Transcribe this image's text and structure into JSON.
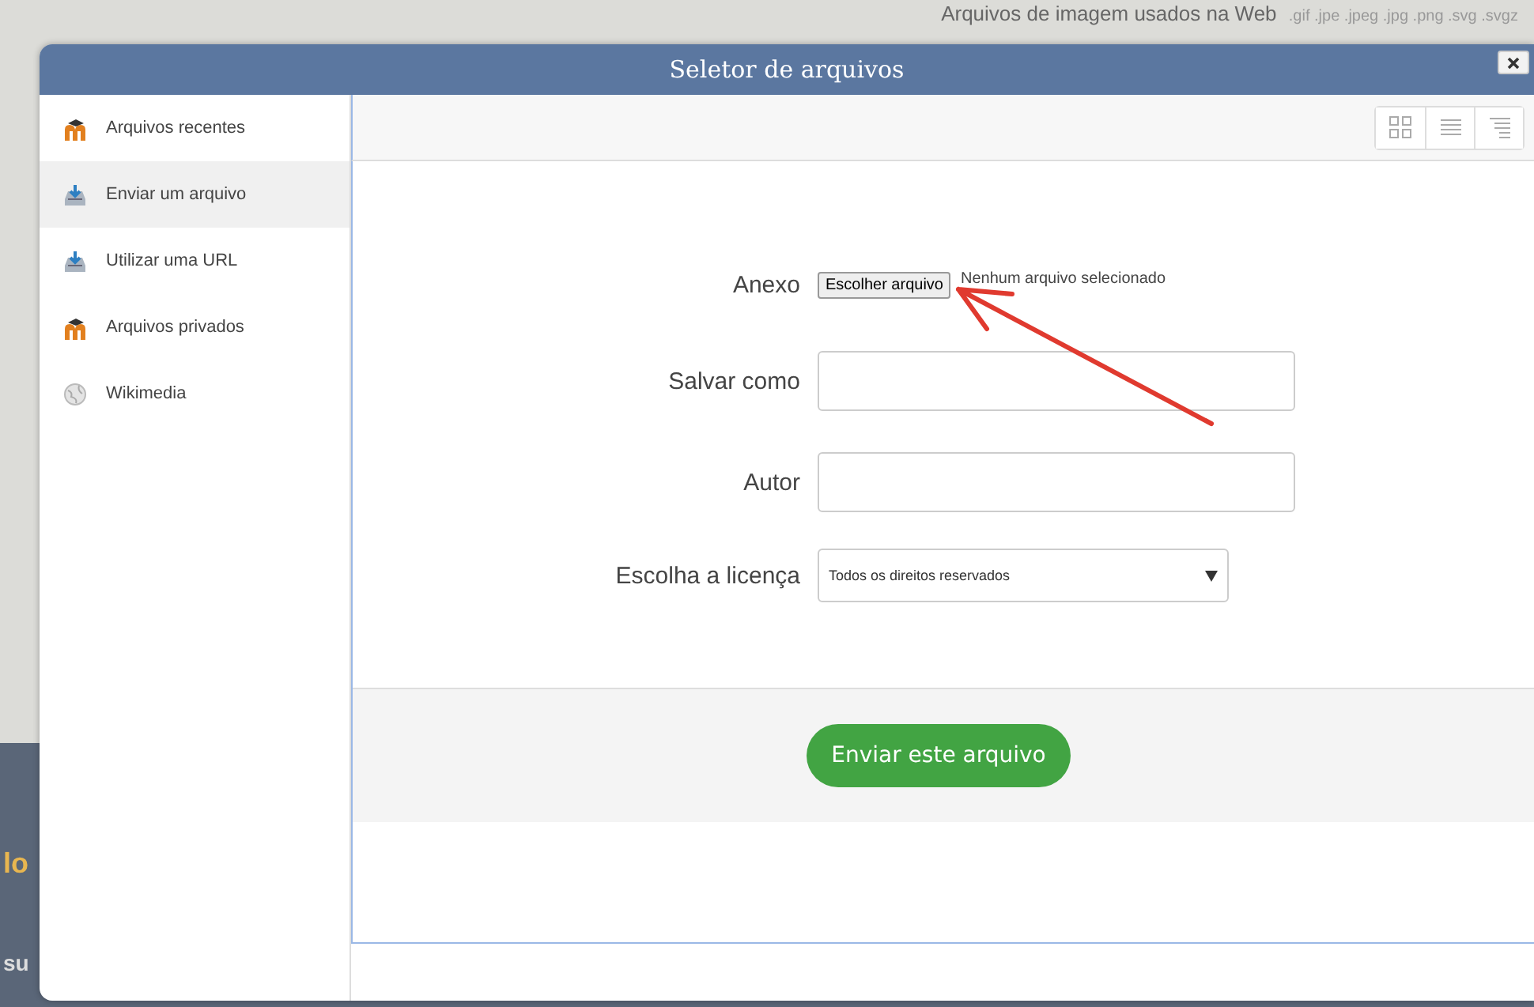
{
  "background": {
    "note": "Arquivos de imagem usados na Web",
    "extensions": ".gif .jpe .jpeg .jpg .png .svg .svgz",
    "fragments": [
      "lo",
      "su"
    ]
  },
  "dialog": {
    "title": "Seletor de arquivos"
  },
  "sidebar": {
    "items": [
      {
        "label": "Arquivos recentes",
        "kind": "moodle",
        "selected": false
      },
      {
        "label": "Enviar um arquivo",
        "kind": "upload",
        "selected": true
      },
      {
        "label": "Utilizar uma URL",
        "kind": "upload",
        "selected": false
      },
      {
        "label": "Arquivos privados",
        "kind": "moodle",
        "selected": false
      },
      {
        "label": "Wikimedia",
        "kind": "globe",
        "selected": false
      }
    ]
  },
  "form": {
    "attachment": {
      "label": "Anexo",
      "button": "Escolher arquivo",
      "status": "Nenhum arquivo selecionado"
    },
    "fields": [
      {
        "kind": "text",
        "label": "Salvar como"
      },
      {
        "kind": "text",
        "label": "Autor"
      },
      {
        "kind": "select",
        "label": "Escolha a licença",
        "value": "Todos os direitos reservados"
      }
    ]
  },
  "submit": "Enviar este arquivo"
}
